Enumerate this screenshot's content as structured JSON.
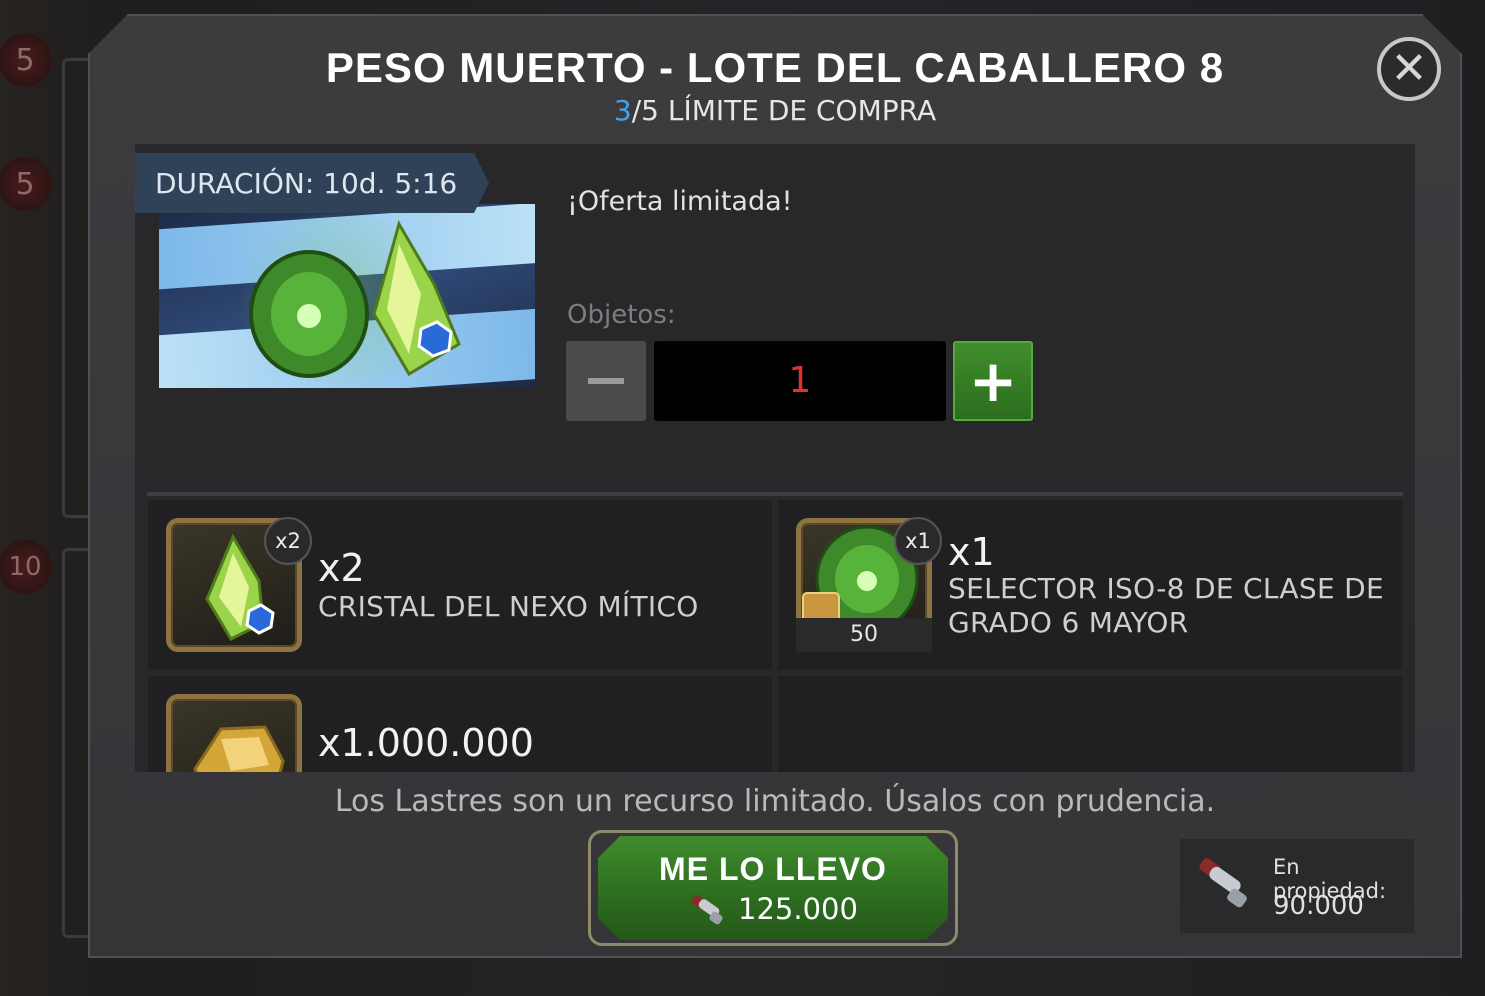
{
  "modal": {
    "title": "PESO MUERTO - LOTE DEL CABALLERO 8",
    "limit_current": "3",
    "limit_rest": "/5 LÍMITE DE COMPRA",
    "close_glyph": "✕"
  },
  "offer": {
    "duration": "DURACIÓN: 10d. 5:16",
    "headline": "¡Oferta limitada!",
    "objects_label": "Objetos:",
    "quantity": "1"
  },
  "items": [
    {
      "badge": "x2",
      "count": "x2",
      "name": "CRISTAL DEL NEXO MÍTICO",
      "icon": "nexus-crystal-icon"
    },
    {
      "badge": "x1",
      "count": "x1",
      "name_line1": "SELECTOR ISO-8 DE CLASE DE",
      "name_line2": "GRADO 6 MAYOR",
      "sub_value": "50",
      "icon": "iso8-selector-icon"
    },
    {
      "count": "x1.000.000",
      "icon": "gold-icon"
    }
  ],
  "footer": {
    "warning": "Los Lastres son un recurso limitado. Úsalos con prudencia.",
    "buy_label": "ME LO LLEVO",
    "buy_price": "125.000",
    "owned_label": "En propiedad:",
    "owned_value": "90.000"
  },
  "background": {
    "badges": [
      "5",
      "5",
      "10"
    ]
  },
  "colors": {
    "accent_green": "#2f7a22",
    "limit_blue": "#4aa0e8",
    "qty_red": "#e03030",
    "duration_bg": "#2f4257"
  }
}
